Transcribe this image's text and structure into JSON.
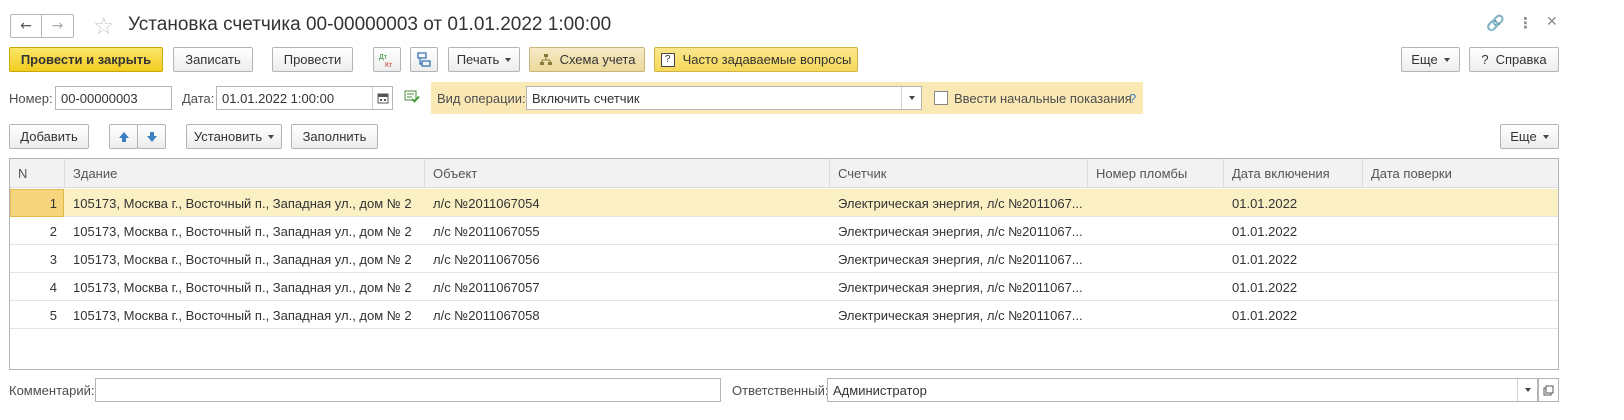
{
  "window": {
    "title": "Установка счетчика 00-00000003 от 01.01.2022 1:00:00"
  },
  "toolbar": {
    "post_close": "Провести и закрыть",
    "save": "Записать",
    "post": "Провести",
    "dtkt": "Дт Кт",
    "print": "Печать",
    "scheme": "Схема учета",
    "faq": "Часто задаваемые вопросы",
    "more": "Еще",
    "help": "Справка"
  },
  "form": {
    "number_label": "Номер:",
    "number_value": "00-00000003",
    "date_label": "Дата:",
    "date_value": "01.01.2022  1:00:00",
    "op_label": "Вид операции:",
    "op_value": "Включить счетчик",
    "initial_label": "Ввести начальные показания",
    "initial_help": "?",
    "initial_checked": false
  },
  "table_toolbar": {
    "add": "Добавить",
    "set": "Установить",
    "fill": "Заполнить",
    "more": "Еще"
  },
  "table": {
    "columns": [
      "N",
      "Здание",
      "Объект",
      "Счетчик",
      "Номер пломбы",
      "Дата включения",
      "Дата поверки"
    ],
    "rows": [
      {
        "n": "1",
        "building": "105173, Москва г., Восточный п., Западная ул., дом № 2",
        "object": "л/с №2011067054",
        "meter": "Электрическая энергия, л/с №2011067...",
        "seal": "",
        "on_date": "01.01.2022",
        "check_date": ""
      },
      {
        "n": "2",
        "building": "105173, Москва г., Восточный п., Западная ул., дом № 2",
        "object": "л/с №2011067055",
        "meter": "Электрическая энергия, л/с №2011067...",
        "seal": "",
        "on_date": "01.01.2022",
        "check_date": ""
      },
      {
        "n": "3",
        "building": "105173, Москва г., Восточный п., Западная ул., дом № 2",
        "object": "л/с №2011067056",
        "meter": "Электрическая энергия, л/с №2011067...",
        "seal": "",
        "on_date": "01.01.2022",
        "check_date": ""
      },
      {
        "n": "4",
        "building": "105173, Москва г., Восточный п., Западная ул., дом № 2",
        "object": "л/с №2011067057",
        "meter": "Электрическая энергия, л/с №2011067...",
        "seal": "",
        "on_date": "01.01.2022",
        "check_date": ""
      },
      {
        "n": "5",
        "building": "105173, Москва г., Восточный п., Западная ул., дом № 2",
        "object": "л/с №2011067058",
        "meter": "Электрическая энергия, л/с №2011067...",
        "seal": "",
        "on_date": "01.01.2022",
        "check_date": ""
      }
    ]
  },
  "footer": {
    "comment_label": "Комментарий:",
    "comment_value": "",
    "responsible_label": "Ответственный:",
    "responsible_value": "Администратор"
  }
}
